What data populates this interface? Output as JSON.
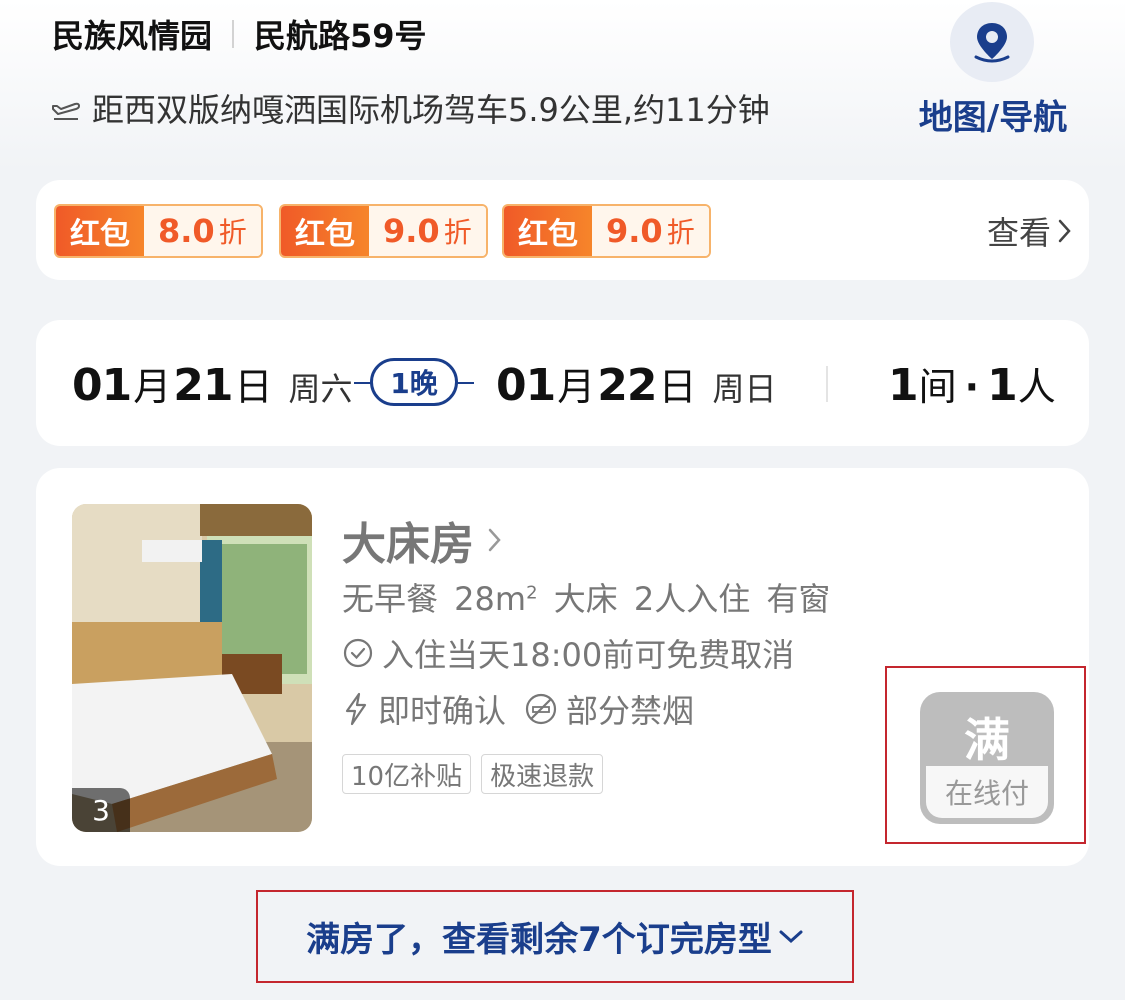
{
  "header": {
    "hotel_name": "民族风情园",
    "street": "民航路59号",
    "distance": "距西双版纳嘎洒国际机场驾车5.9公里,约11分钟",
    "map_label": "地图/导航"
  },
  "coupons": {
    "items": [
      {
        "tag": "红包",
        "value": "8.0",
        "unit": "折"
      },
      {
        "tag": "红包",
        "value": "9.0",
        "unit": "折"
      },
      {
        "tag": "红包",
        "value": "9.0",
        "unit": "折"
      }
    ],
    "view_label": "查看"
  },
  "stay": {
    "checkin": {
      "month": "01",
      "month_unit": "月",
      "day": "21",
      "day_unit": "日",
      "weekday": "周六"
    },
    "nights": "1晚",
    "checkout": {
      "month": "01",
      "month_unit": "月",
      "day": "22",
      "day_unit": "日",
      "weekday": "周日"
    },
    "rooms": {
      "count": "1",
      "unit": "间"
    },
    "dot": "·",
    "guests": {
      "count": "1",
      "unit": "人"
    }
  },
  "room": {
    "name": "大床房",
    "specs": "无早餐 28m",
    "specs_sup": "2",
    "specs_rest": " 大床 2人入住 有窗",
    "cancel_policy": "入住当天18:00前可免费取消",
    "confirm": "即时确认",
    "smoking": "部分禁烟",
    "tags": [
      "10亿补贴",
      "极速退款"
    ],
    "photo_count": "3",
    "status": "满",
    "pay_type": "在线付"
  },
  "soldout_link": "满房了，查看剩余7个订完房型",
  "colors": {
    "brand_blue": "#1a3e8c",
    "coupon_orange": "#f05a28",
    "highlight_red": "#c4262e",
    "disabled_gray": "#bdbdbd"
  }
}
